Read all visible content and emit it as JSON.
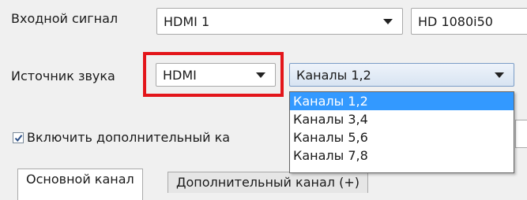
{
  "input_signal": {
    "label": "Входной сигнал",
    "source_value": "HDMI 1",
    "format_value": "HD 1080i50"
  },
  "audio_source": {
    "label": "Источник звука",
    "source_value": "HDMI",
    "channel_value": "Каналы 1,2",
    "highlight_color": "#e3151a"
  },
  "channel_dropdown": {
    "options": [
      "Каналы 1,2",
      "Каналы 3,4",
      "Каналы 5,6",
      "Каналы 7,8"
    ],
    "selected_index": 0,
    "selected_color": "#3399ff"
  },
  "extra_channel": {
    "checkbox_label": "Включить дополнительный ка",
    "checked": true
  },
  "tabs": [
    "Основной канал",
    "Дополнительный канал (+)"
  ]
}
